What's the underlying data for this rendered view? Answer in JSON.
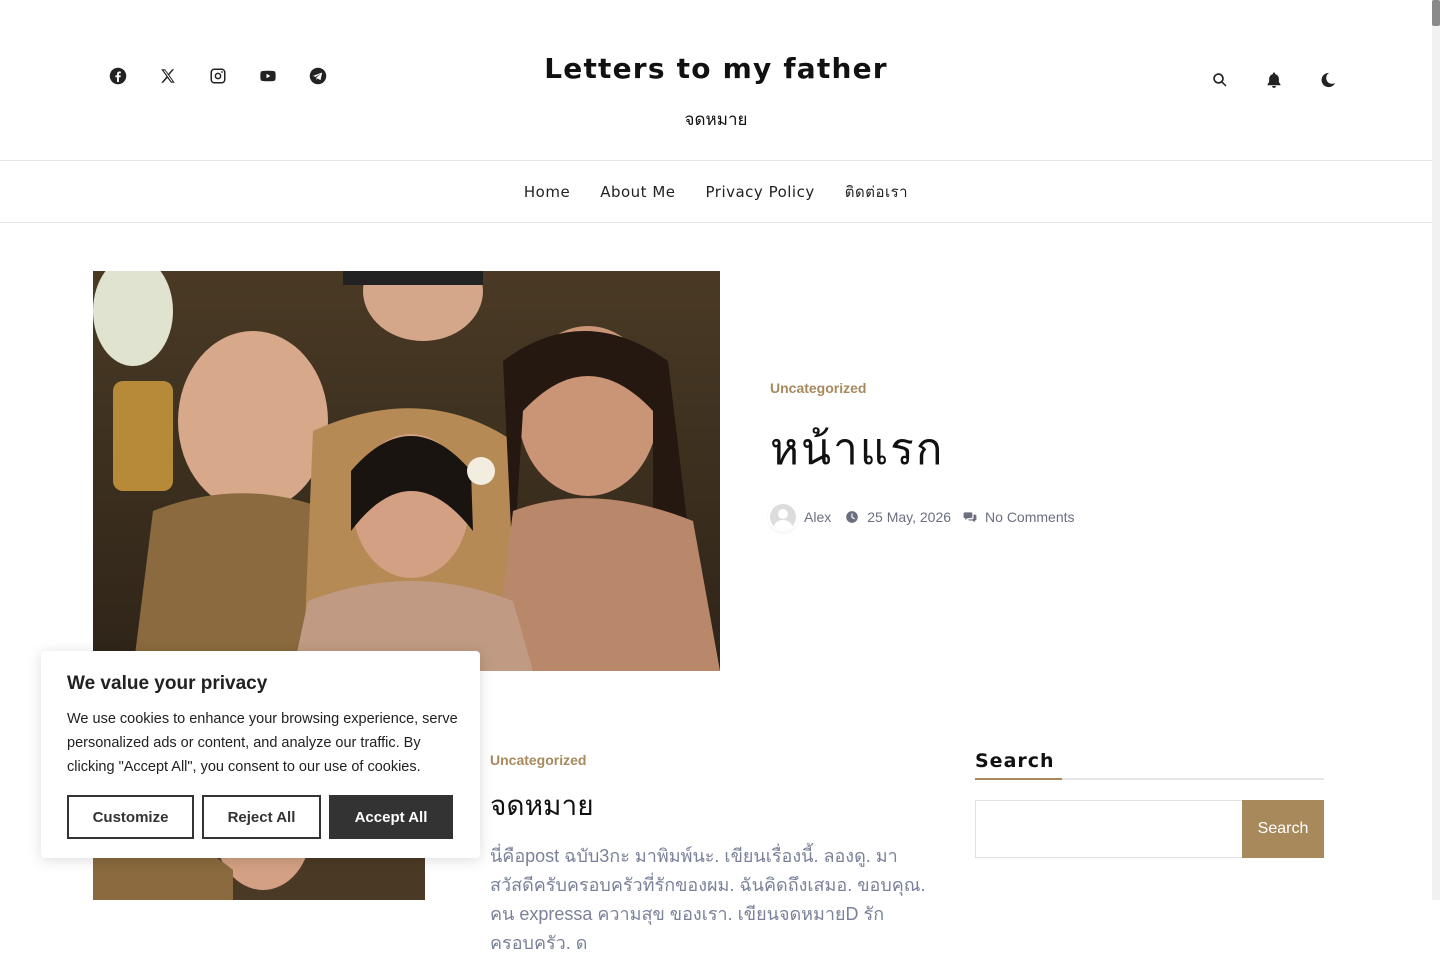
{
  "header": {
    "site_title": "Letters to my father",
    "tagline": "จดหมาย",
    "social_icons": [
      "facebook-icon",
      "x-icon",
      "instagram-icon",
      "youtube-icon",
      "telegram-icon"
    ],
    "tool_icons": [
      "search-icon",
      "bell-icon",
      "moon-icon"
    ]
  },
  "nav": {
    "items": [
      "Home",
      "About Me",
      "Privacy Policy",
      "ติดต่อเรา"
    ]
  },
  "featured": {
    "category": "Uncategorized",
    "title": "หน้าแรก",
    "author": "Alex",
    "date": "25 May, 2026",
    "comments": "No Comments"
  },
  "post2": {
    "category": "Uncategorized",
    "title": "จดหมาย",
    "excerpt": "นี่คือpost ฉบับ3กะ มาพิมพ์นะ. เขียนเรื่องนี้. ลองดู. มา สวัสดีครับครอบครัวที่รักของผม. ฉันคิดถึงเสมอ. ขอบคุณ. คน expressa ความสุข ของเรา. เขียนจดหมายD รักครอบครัว. ด"
  },
  "sidebar": {
    "search_title": "Search",
    "search_placeholder": "",
    "search_button": "Search"
  },
  "cookie": {
    "title": "We value your privacy",
    "text": "We use cookies to enhance your browsing experience, serve personalized ads or content, and analyze our traffic. By clicking \"Accept All\", you consent to our use of cookies.",
    "customize": "Customize",
    "reject": "Reject All",
    "accept": "Accept All"
  },
  "colors": {
    "accent": "#a8895b",
    "text": "#222222",
    "meta": "#6b6f80"
  }
}
